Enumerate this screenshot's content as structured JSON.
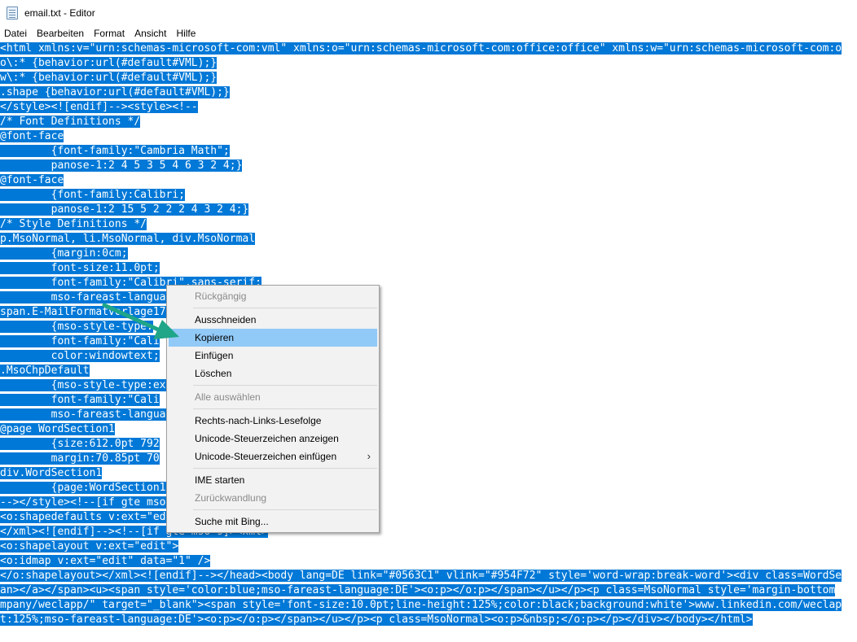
{
  "window": {
    "title": "email.txt - Editor"
  },
  "menu": [
    "Datei",
    "Bearbeiten",
    "Format",
    "Ansicht",
    "Hilfe"
  ],
  "lines": [
    "<html xmlns:v=\"urn:schemas-microsoft-com:vml\" xmlns:o=\"urn:schemas-microsoft-com:office:office\" xmlns:w=\"urn:schemas-microsoft-com:o",
    "o\\:* {behavior:url(#default#VML);}",
    "w\\:* {behavior:url(#default#VML);}",
    ".shape {behavior:url(#default#VML);}",
    "</style><![endif]--><style><!--",
    "/* Font Definitions */",
    "@font-face",
    "        {font-family:\"Cambria Math\";",
    "        panose-1:2 4 5 3 5 4 6 3 2 4;}",
    "@font-face",
    "        {font-family:Calibri;",
    "        panose-1:2 15 5 2 2 2 4 3 2 4;}",
    "/* Style Definitions */",
    "p.MsoNormal, li.MsoNormal, div.MsoNormal",
    "        {margin:0cm;",
    "        font-size:11.0pt;",
    "        font-family:\"Calibri\",sans-serif;",
    "        mso-fareast-langua",
    "span.E-MailFormatvorlage17",
    "        {mso-style-type:",
    "        font-family:\"Cali",
    "        color:windowtext;",
    ".MsoChpDefault",
    "        {mso-style-type:ex",
    "        font-family:\"Cali",
    "        mso-fareast-langua",
    "@page WordSection1",
    "        {size:612.0pt 792",
    "        margin:70.85pt 70",
    "div.WordSection1",
    "        {page:WordSection1",
    "--></style><!--[if gte mso",
    "<o:shapedefaults v:ext=\"ed",
    "</xml><![endif]--><!--[if gte mso 9]><xml>",
    "<o:shapelayout v:ext=\"edit\">",
    "<o:idmap v:ext=\"edit\" data=\"1\" />",
    "</o:shapelayout></xml><![endif]--></head><body lang=DE link=\"#0563C1\" vlink=\"#954F72\" style='word-wrap:break-word'><div class=WordSe",
    "an></a></span><u><span style='color:blue;mso-fareast-language:DE'><o:p></o:p></span></u></p><p class=MsoNormal style='margin-bottom",
    "mpany/weclapp/\" target=\"_blank\"><span style='font-size:10.0pt;line-height:125%;color:black;background:white'>www.linkedin.com/weclap",
    "t:125%;mso-fareast-language:DE'><o:p></o:p></span></u></p><p class=MsoNormal><o:p>&nbsp;</o:p></p></div></body></html>"
  ],
  "context_menu": {
    "undo": "Rückgängig",
    "cut": "Ausschneiden",
    "copy": "Kopieren",
    "paste": "Einfügen",
    "delete": "Löschen",
    "select_all": "Alle auswählen",
    "rtl": "Rechts-nach-Links-Lesefolge",
    "show_unicode": "Unicode-Steuerzeichen anzeigen",
    "insert_unicode": "Unicode-Steuerzeichen einfügen",
    "ime_open": "IME starten",
    "reconversion": "Zurückwandlung",
    "search_bing": "Suche mit Bing..."
  },
  "colors": {
    "selection": "#0078d7",
    "highlight": "#91c9f7",
    "arrow": "#1fa588"
  },
  "icons": {
    "submenu": "chevron-right-icon",
    "app": "notepad-icon",
    "annotation": "arrow-icon"
  }
}
